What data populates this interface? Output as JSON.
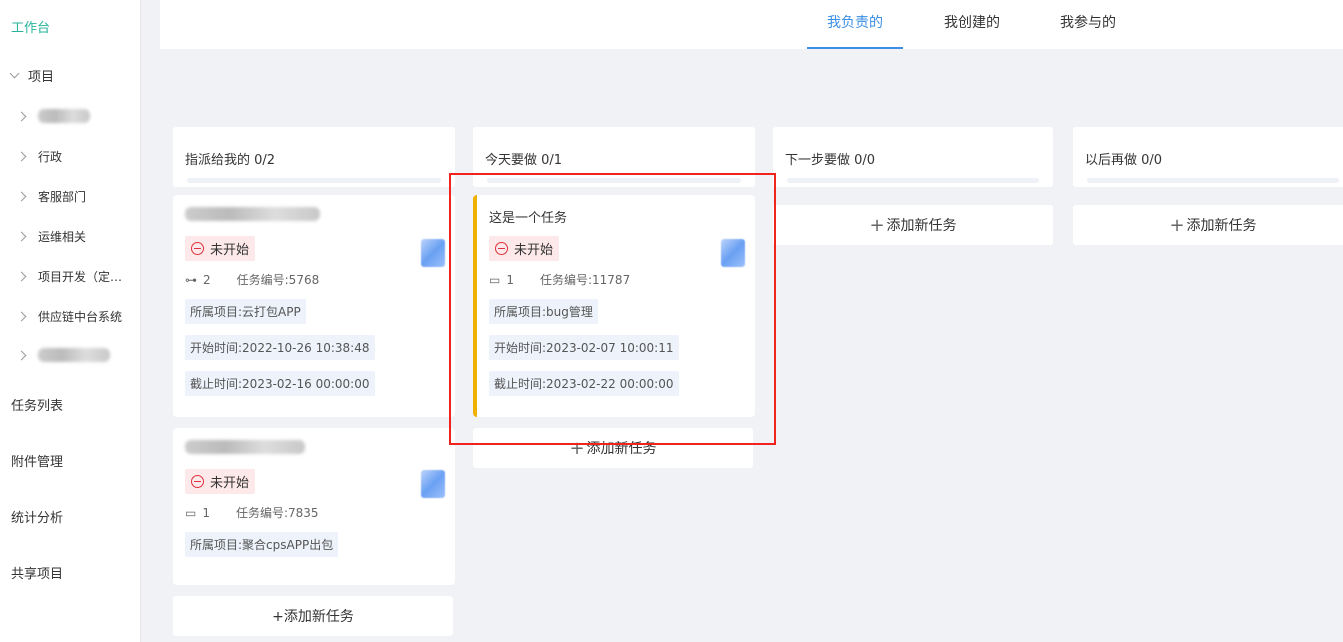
{
  "sidebar": {
    "workbench": "工作台",
    "project_group": "项目",
    "projects": [
      "行政",
      "客服部门",
      "运维相关",
      "项目开发（定…",
      "供应链中台系统"
    ],
    "menu": [
      "任务列表",
      "附件管理",
      "统计分析",
      "共享项目"
    ]
  },
  "tabs": [
    "我负责的",
    "我创建的",
    "我参与的"
  ],
  "columns": [
    {
      "title": "指派给我的 0/2"
    },
    {
      "title": "今天要做 0/1"
    },
    {
      "title": "下一步要做 0/0"
    },
    {
      "title": "以后再做 0/0"
    }
  ],
  "add_task": "+添加新任务",
  "add_label": "添加新任务",
  "cards": {
    "c1": {
      "status": "未开始",
      "count": "2",
      "task_no": "任务编号:5768",
      "project": "所属项目:云打包APP",
      "start": "开始时间:2022-10-26 10:38:48",
      "end": "截止时间:2023-02-16 00:00:00"
    },
    "c2": {
      "status": "未开始",
      "count": "1",
      "task_no": "任务编号:7835",
      "project": "所属项目:聚合cpsAPP出包"
    },
    "c3": {
      "title": "这是一个任务",
      "status": "未开始",
      "count": "1",
      "task_no": "任务编号:11787",
      "project": "所属项目:bug管理",
      "start": "开始时间:2023-02-07 10:00:11",
      "end": "截止时间:2023-02-22 00:00:00"
    }
  }
}
